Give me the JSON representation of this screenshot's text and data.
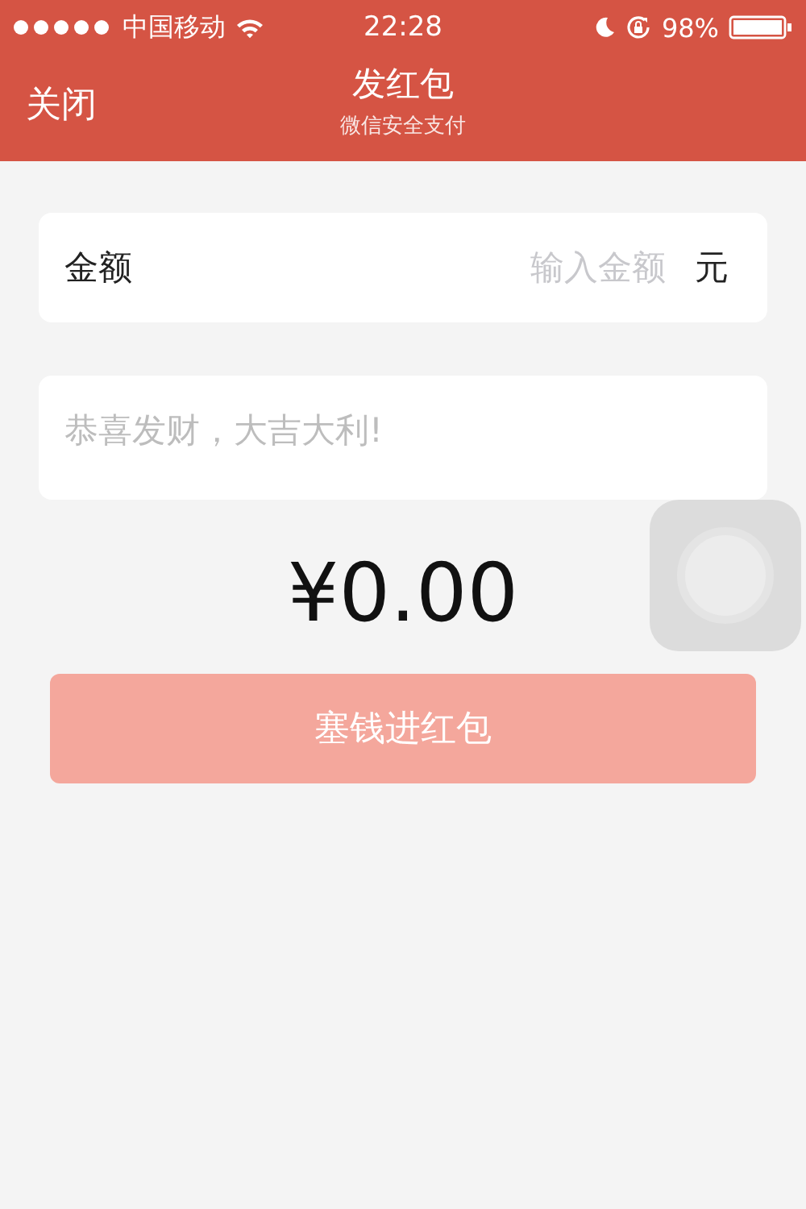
{
  "status_bar": {
    "carrier": "中国移动",
    "time": "22:28",
    "battery": "98%"
  },
  "nav": {
    "close": "关闭",
    "title": "发红包",
    "subtitle": "微信安全支付"
  },
  "amount_field": {
    "label": "金额",
    "placeholder": "输入金额",
    "unit": "元"
  },
  "message_field": {
    "placeholder": "恭喜发财，大吉大利!"
  },
  "total": "¥0.00",
  "submit": {
    "label": "塞钱进红包",
    "disabled": true
  }
}
